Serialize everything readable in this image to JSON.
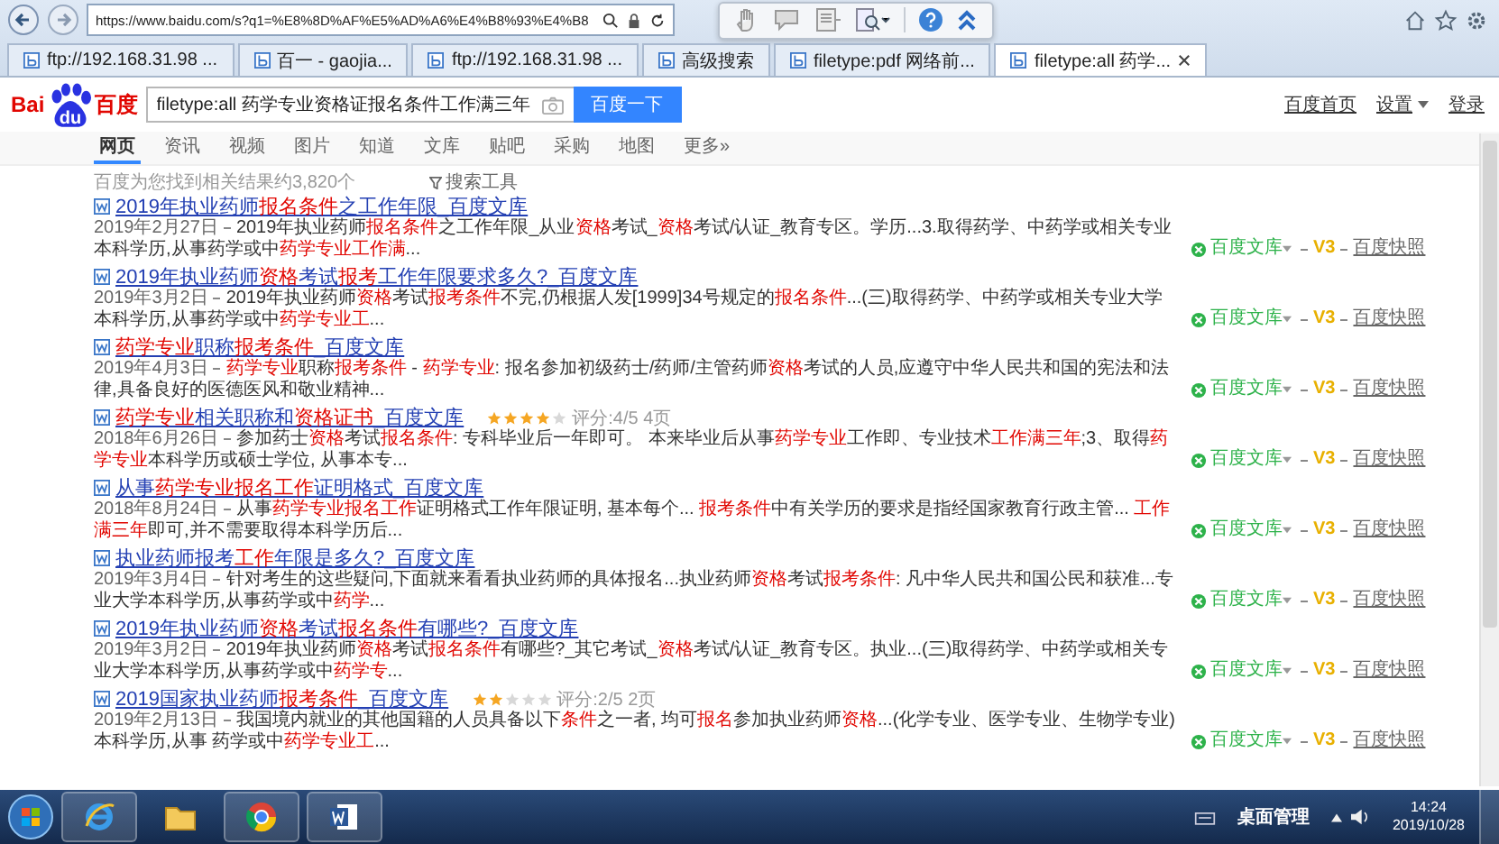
{
  "browser": {
    "address": "https://www.baidu.com/s?q1=%E8%8D%AF%E5%AD%A6%E4%B8%93%E4%B8",
    "tabs": [
      {
        "label": "ftp://192.168.31.98 ...",
        "selected": false
      },
      {
        "label": "百一 - gaojia...",
        "selected": false
      },
      {
        "label": "ftp://192.168.31.98 ...",
        "selected": false
      },
      {
        "label": "高级搜索",
        "selected": false
      },
      {
        "label": "filetype:pdf 网络前...",
        "selected": false
      },
      {
        "label": "filetype:all 药学...",
        "selected": true
      }
    ]
  },
  "logo": {
    "left": "Bai",
    "mark": "du",
    "right": "百度"
  },
  "search": {
    "value": "filetype:all 药学专业资格证报名条件工作满三年",
    "button": "百度一下"
  },
  "header_links": [
    "百度首页",
    "设置",
    "登录"
  ],
  "nav": [
    {
      "label": "网页",
      "selected": true
    },
    {
      "label": "资讯",
      "selected": false
    },
    {
      "label": "视频",
      "selected": false
    },
    {
      "label": "图片",
      "selected": false
    },
    {
      "label": "知道",
      "selected": false
    },
    {
      "label": "文库",
      "selected": false
    },
    {
      "label": "贴吧",
      "selected": false
    },
    {
      "label": "采购",
      "selected": false
    },
    {
      "label": "地图",
      "selected": false
    },
    {
      "label": "更多»",
      "selected": false
    }
  ],
  "result_count": "百度为您找到相关结果约3,820个",
  "search_tools": "搜索工具",
  "results": [
    {
      "title": "2019年执业药师**报名条件**之工作年限_百度文库",
      "date": "2019年2月27日",
      "snippet": "2019年执业药师**报名条件**之工作年限_从业**资格**考试_**资格**考试/认证_教育专区。学历...3.取得药学、中药学或相关专业本科学历,从事药学或中**药学专业工作满**...",
      "source": "百度文库",
      "badge": "V3",
      "cache": "百度快照"
    },
    {
      "title": "2019年执业药师**资格**考试**报考**工作年限要求多久?_百度文库",
      "date": "2019年3月2日",
      "snippet": "2019年执业药师**资格**考试**报考条件**不完,仍根据人发[1999]34号规定的**报名条件**...(三)取得药学、中药学或相关专业大学本科学历,从事药学或中**药学专业工**...",
      "source": "百度文库",
      "badge": "V3",
      "cache": "百度快照"
    },
    {
      "title": "**药学专业**职称**报考条件**_百度文库",
      "date": "2019年4月3日",
      "snippet": "**药学专业**职称**报考条件** - **药学专业**: 报名参加初级药士/药师/主管药师**资格**考试的人员,应遵守中华人民共和国的宪法和法律,具备良好的医德医风和敬业精神...",
      "source": "百度文库",
      "badge": "V3",
      "cache": "百度快照"
    },
    {
      "title": "**药学专业**相关职称和**资格证书**_百度文库",
      "stars": 4,
      "rating": "评分:4/5 4页",
      "date": "2018年6月26日",
      "snippet": "参加药士**资格**考试**报名条件**: 专科毕业后一年即可。 本来毕业后从事**药学专业**工作即、专业技术**工作满三年**;3、取得**药学专业**本科学历或硕士学位, 从事本专...",
      "source": "百度文库",
      "badge": "V3",
      "cache": "百度快照"
    },
    {
      "title": "从事**药学专业报名工作**证明格式_百度文库",
      "date": "2018年8月24日",
      "snippet": "从事**药学专业报名工作**证明格式工作年限证明, 基本每个... **报考条件**中有关学历的要求是指经国家教育行政主管... **工作满三年**即可,并不需要取得本科学历后...",
      "source": "百度文库",
      "badge": "V3",
      "cache": "百度快照"
    },
    {
      "title": "执业药师报考**工作**年限是多久?_百度文库",
      "date": "2019年3月4日",
      "snippet": "针对考生的这些疑问,下面就来看看执业药师的具体报名...执业药师**资格**考试**报考条件**: 凡中华人民共和国公民和获准...专业大学本科学历,从事药学或中**药学**...",
      "source": "百度文库",
      "badge": "V3",
      "cache": "百度快照"
    },
    {
      "title": "2019年执业药师**资格**考试**报名条件**有哪些?_百度文库",
      "date": "2019年3月2日",
      "snippet": "2019年执业药师**资格**考试**报名条件**有哪些?_其它考试_**资格**考试/认证_教育专区。执业...(三)取得药学、中药学或相关专业大学本科学历,从事药学或中**药学专**...",
      "source": "百度文库",
      "badge": "V3",
      "cache": "百度快照"
    },
    {
      "title": "2019国家执业药师**报考条件**_百度文库",
      "stars": 2,
      "rating": "评分:2/5 2页",
      "date": "2019年2月13日",
      "snippet": "我国境内就业的其他国籍的人员具备以下**条件**之一者, 均可**报名**参加执业药师**资格**...(化学专业、医学专业、生物学专业)本科学历,从事 药学或中**药学专业工**...",
      "source": "百度文库",
      "badge": "V3",
      "cache": "百度快照"
    }
  ],
  "taskbar": {
    "tray_label": "桌面管理",
    "time": "14:24",
    "date": "2019/10/28"
  }
}
